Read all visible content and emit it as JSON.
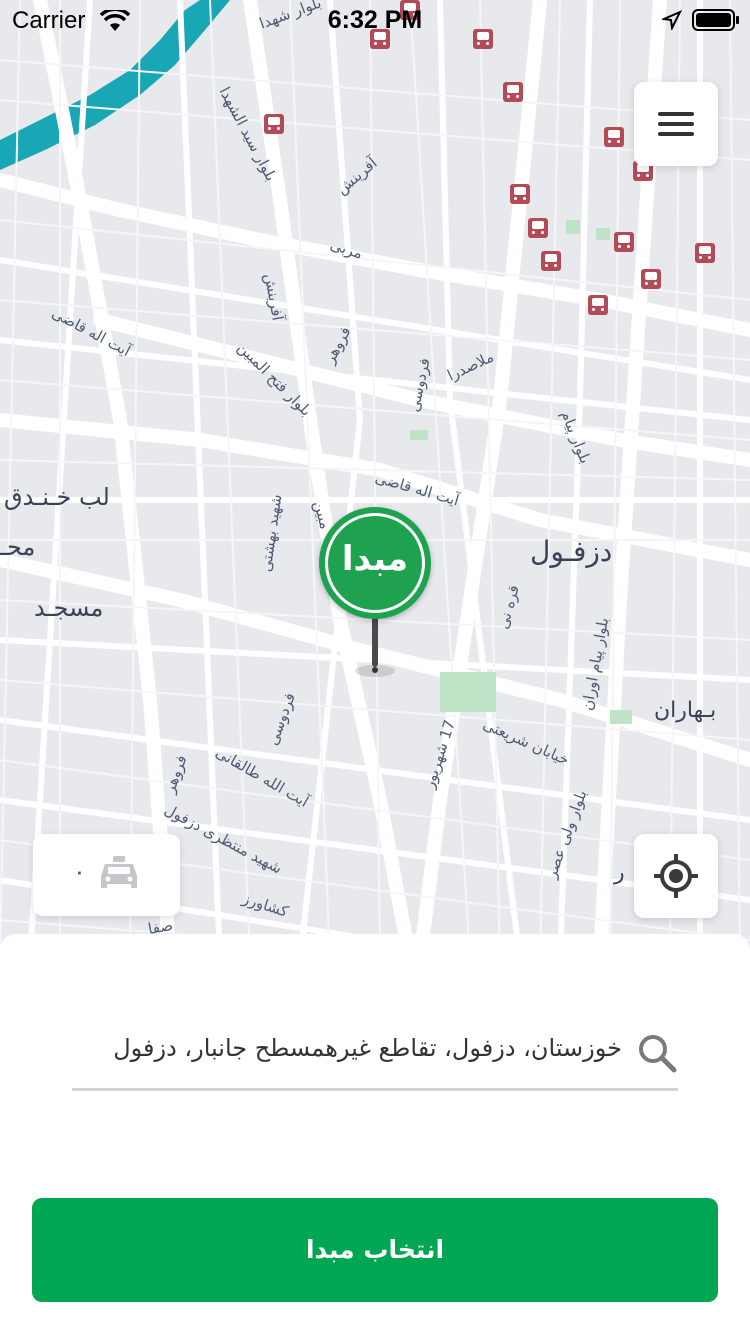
{
  "status_bar": {
    "carrier": "Carrier",
    "time": "6:32 PM"
  },
  "map": {
    "icons": {
      "menu": "hamburger-menu-icon",
      "locate": "crosshair-icon",
      "taxi": "taxi-car-icon",
      "bus_stop": "bus-stop-icon"
    },
    "colors": {
      "river": "#19a6b5",
      "bus_stop": "#b24b57",
      "park": "#bfe3c6"
    },
    "labels": {
      "shohada_1": "بلوار شهدا",
      "sayed": "بلوار سید الشهدا",
      "afarinesh_1": "آفرینش",
      "afarinesh_2": "آفرینش",
      "morabbi": "مربی",
      "ayatollah_qazi_1": "آیت اله قاضی",
      "ayatollah_qazi_2": "آیت اله قاضی",
      "fath_ol_mobin": "بلوار فتح المبین",
      "forouhar_1": "فروهر",
      "ferdowsi_1": "فردوسی",
      "molla_sadra": "ملاصدرا",
      "payam": "بلوار پیام",
      "lab_khandaq": "لب خـنـدق",
      "mahalleh": "محـ",
      "masjed": "مسجـد",
      "shahid_beheshti": "شهید بهشتی",
      "mobin": "مبین",
      "dezful": "دزفـول",
      "qareh_ney": "قره نی",
      "payam_ovaran": "بلوار پیام اوران",
      "baharan": "بـهاران",
      "khiaban_shariati": "خیابان شریعتی",
      "shahrivar": "17 شهریور",
      "ferdowsi_2": "فردوسی",
      "taleqani": "آیت الله طالقانی",
      "forouhar_2": "فروهر",
      "montazeri": "شهید منتظری دزفول",
      "vali_asr": "بلوار ولی عصر",
      "keshavarz": "کشاورز",
      "side_r": "ر",
      "side_saf": "صفا"
    },
    "pin_label": "مبدا",
    "taxi_count": "۰"
  },
  "bottom_sheet": {
    "search_value": "خوزستان، دزفول، تقاطع غیرهمسطح جانبار، دزفول",
    "select_button": "انتخاب مبدا"
  }
}
